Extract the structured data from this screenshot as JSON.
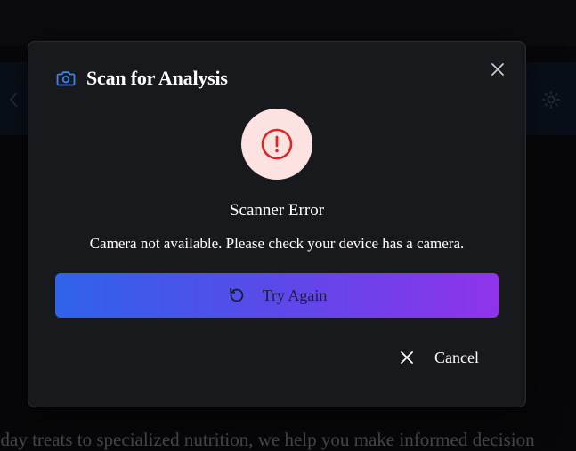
{
  "background": {
    "tagline_fragment": "yday treats to specialized nutrition, we help you make informed decision"
  },
  "modal": {
    "title": "Scan for Analysis",
    "title_icon": "camera-icon",
    "close_icon": "close-icon",
    "error": {
      "icon": "alert-circle-icon",
      "heading": "Scanner Error",
      "message": "Camera not available. Please check your device has a camera."
    },
    "try_again": {
      "label": "Try Again",
      "icon": "retry-icon"
    },
    "cancel": {
      "label": "Cancel",
      "icon": "close-icon"
    }
  },
  "colors": {
    "accent_blue": "#2f63ea",
    "accent_purple": "#8f34ea",
    "error_red": "#dc2626",
    "error_bg": "#fde2e2",
    "camera_icon_blue": "#3b82f6"
  }
}
